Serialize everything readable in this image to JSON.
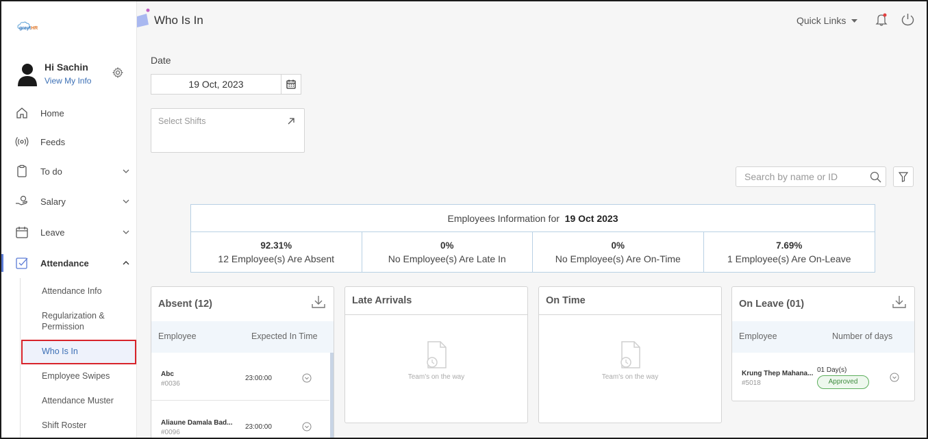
{
  "app": {
    "logo_prefix": "greyt",
    "logo_suffix": "HR"
  },
  "user": {
    "greeting": "Hi Sachin",
    "view_info": "View My Info"
  },
  "nav": {
    "home": "Home",
    "feeds": "Feeds",
    "todo": "To do",
    "salary": "Salary",
    "leave": "Leave",
    "attendance": "Attendance"
  },
  "subnav": {
    "attendance_info": "Attendance Info",
    "regularization_line1": "Regularization &",
    "regularization_line2": "Permission",
    "who_is_in": "Who Is In",
    "employee_swipes": "Employee Swipes",
    "attendance_muster": "Attendance Muster",
    "shift_roster": "Shift Roster"
  },
  "header": {
    "title": "Who Is In",
    "quick_links": "Quick Links"
  },
  "filters": {
    "date_label": "Date",
    "date_value": "19 Oct, 2023",
    "shift_placeholder": "Select Shifts",
    "search_placeholder": "Search by name or ID"
  },
  "summary": {
    "heading_prefix": "Employees Information for",
    "heading_date": "19 Oct 2023",
    "cells": [
      {
        "pct": "92.31%",
        "text": "12 Employee(s) Are Absent"
      },
      {
        "pct": "0%",
        "text": "No Employee(s) Are Late In"
      },
      {
        "pct": "0%",
        "text": "No Employee(s) Are On-Time"
      },
      {
        "pct": "7.69%",
        "text": "1 Employee(s) Are On-Leave"
      }
    ]
  },
  "absent": {
    "title": "Absent (12)",
    "col_employee": "Employee",
    "col_time": "Expected In Time",
    "rows": [
      {
        "name": "Abc",
        "id": "#0036",
        "time": "23:00:00"
      },
      {
        "name": "Aliaune Damala Bad...",
        "id": "#0096",
        "time": "23:00:00"
      }
    ]
  },
  "late": {
    "title": "Late Arrivals",
    "empty": "Team's on the way"
  },
  "ontime": {
    "title": "On Time",
    "empty": "Team's on the way"
  },
  "onleave": {
    "title": "On Leave (01)",
    "col_employee": "Employee",
    "col_days": "Number of days",
    "row": {
      "name": "Krung Thep Mahana...",
      "id": "#5018",
      "days": "01 Day(s)",
      "status": "Approved"
    }
  },
  "colors": {
    "accent": "#3b6fb5",
    "highlight": "#d8232a",
    "approved": "#3d8b3d",
    "table_border": "#b8d0e4"
  }
}
